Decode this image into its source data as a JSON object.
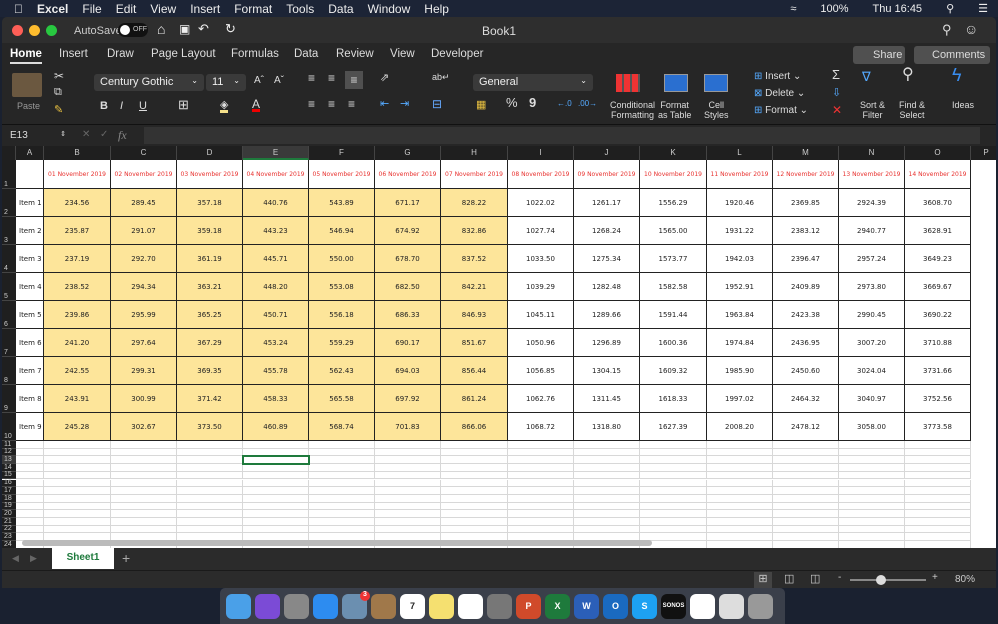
{
  "menubar": {
    "app": "Excel",
    "items": [
      "File",
      "Edit",
      "View",
      "Insert",
      "Format",
      "Tools",
      "Data",
      "Window",
      "Help"
    ],
    "battery": "100%",
    "clock": "Thu 16:45"
  },
  "titlebar": {
    "autosave": "AutoSave",
    "autosave_state": "OFF",
    "title": "Book1"
  },
  "tabs": [
    "Home",
    "Insert",
    "Draw",
    "Page Layout",
    "Formulas",
    "Data",
    "Review",
    "View",
    "Developer"
  ],
  "active_tab": "Home",
  "share": "Share",
  "comments": "Comments",
  "ribbon": {
    "paste": "Paste",
    "font": "Century Gothic",
    "size": "11",
    "bold": "B",
    "italic": "I",
    "underline": "U",
    "number_format": "General",
    "percent": "%",
    "comma": "9",
    "cond": "Conditional",
    "cond2": "Formatting",
    "fat": "Format",
    "fat2": "as Table",
    "cs": "Cell",
    "cs2": "Styles",
    "insert": "Insert",
    "delete": "Delete",
    "format": "Format",
    "sort": "Sort &",
    "sort2": "Filter",
    "find": "Find &",
    "find2": "Select",
    "ideas": "Ideas"
  },
  "formula": {
    "name_box": "E13",
    "fx": "fx",
    "value": ""
  },
  "columns": [
    "A",
    "B",
    "C",
    "D",
    "E",
    "F",
    "G",
    "H",
    "I",
    "J",
    "K",
    "L",
    "M",
    "N",
    "O",
    "P"
  ],
  "headers": [
    "01 November 2019",
    "02 November 2019",
    "03 November 2019",
    "04 November 2019",
    "05 November 2019",
    "06 November 2019",
    "07 November 2019",
    "08 November 2019",
    "09 November 2019",
    "10 November 2019",
    "11 November 2019",
    "12 November 2019",
    "13 November 2019",
    "14 November 2019"
  ],
  "rows": [
    {
      "label": "Item 1",
      "values": [
        "234.56",
        "289.45",
        "357.18",
        "440.76",
        "543.89",
        "671.17",
        "828.22",
        "1022.02",
        "1261.17",
        "1556.29",
        "1920.46",
        "2369.85",
        "2924.39",
        "3608.70"
      ]
    },
    {
      "label": "Item 2",
      "values": [
        "235.87",
        "291.07",
        "359.18",
        "443.23",
        "546.94",
        "674.92",
        "832.86",
        "1027.74",
        "1268.24",
        "1565.00",
        "1931.22",
        "2383.12",
        "2940.77",
        "3628.91"
      ]
    },
    {
      "label": "Item 3",
      "values": [
        "237.19",
        "292.70",
        "361.19",
        "445.71",
        "550.00",
        "678.70",
        "837.52",
        "1033.50",
        "1275.34",
        "1573.77",
        "1942.03",
        "2396.47",
        "2957.24",
        "3649.23"
      ]
    },
    {
      "label": "Item 4",
      "values": [
        "238.52",
        "294.34",
        "363.21",
        "448.20",
        "553.08",
        "682.50",
        "842.21",
        "1039.29",
        "1282.48",
        "1582.58",
        "1952.91",
        "2409.89",
        "2973.80",
        "3669.67"
      ]
    },
    {
      "label": "Item 5",
      "values": [
        "239.86",
        "295.99",
        "365.25",
        "450.71",
        "556.18",
        "686.33",
        "846.93",
        "1045.11",
        "1289.66",
        "1591.44",
        "1963.84",
        "2423.38",
        "2990.45",
        "3690.22"
      ]
    },
    {
      "label": "Item 6",
      "values": [
        "241.20",
        "297.64",
        "367.29",
        "453.24",
        "559.29",
        "690.17",
        "851.67",
        "1050.96",
        "1296.89",
        "1600.36",
        "1974.84",
        "2436.95",
        "3007.20",
        "3710.88"
      ]
    },
    {
      "label": "Item 7",
      "values": [
        "242.55",
        "299.31",
        "369.35",
        "455.78",
        "562.43",
        "694.03",
        "856.44",
        "1056.85",
        "1304.15",
        "1609.32",
        "1985.90",
        "2450.60",
        "3024.04",
        "3731.66"
      ]
    },
    {
      "label": "Item 8",
      "values": [
        "243.91",
        "300.99",
        "371.42",
        "458.33",
        "565.58",
        "697.92",
        "861.24",
        "1062.76",
        "1311.45",
        "1618.33",
        "1997.02",
        "2464.32",
        "3040.97",
        "3752.56"
      ]
    },
    {
      "label": "Item 9",
      "values": [
        "245.28",
        "302.67",
        "373.50",
        "460.89",
        "568.74",
        "701.83",
        "866.06",
        "1068.72",
        "1318.80",
        "1627.39",
        "2008.20",
        "2478.12",
        "3058.00",
        "3773.58"
      ]
    }
  ],
  "colors": {
    "header_text": "#e8312e",
    "fill": "#fde59a",
    "selection": "#1e7a3c"
  },
  "sheet_tab": "Sheet1",
  "zoom": "80%",
  "dock": [
    "Finder",
    "Siri",
    "Launchpad",
    "Safari",
    "Mail",
    "Contacts",
    "Calendar",
    "Notes",
    "Photos",
    "System Preferences",
    "PowerPoint",
    "Excel",
    "Word",
    "Outlook",
    "Skype",
    "SONOS",
    "Notability",
    "Preview",
    "Trash"
  ],
  "dock_calendar": "7",
  "dock_mail_badge": "3"
}
